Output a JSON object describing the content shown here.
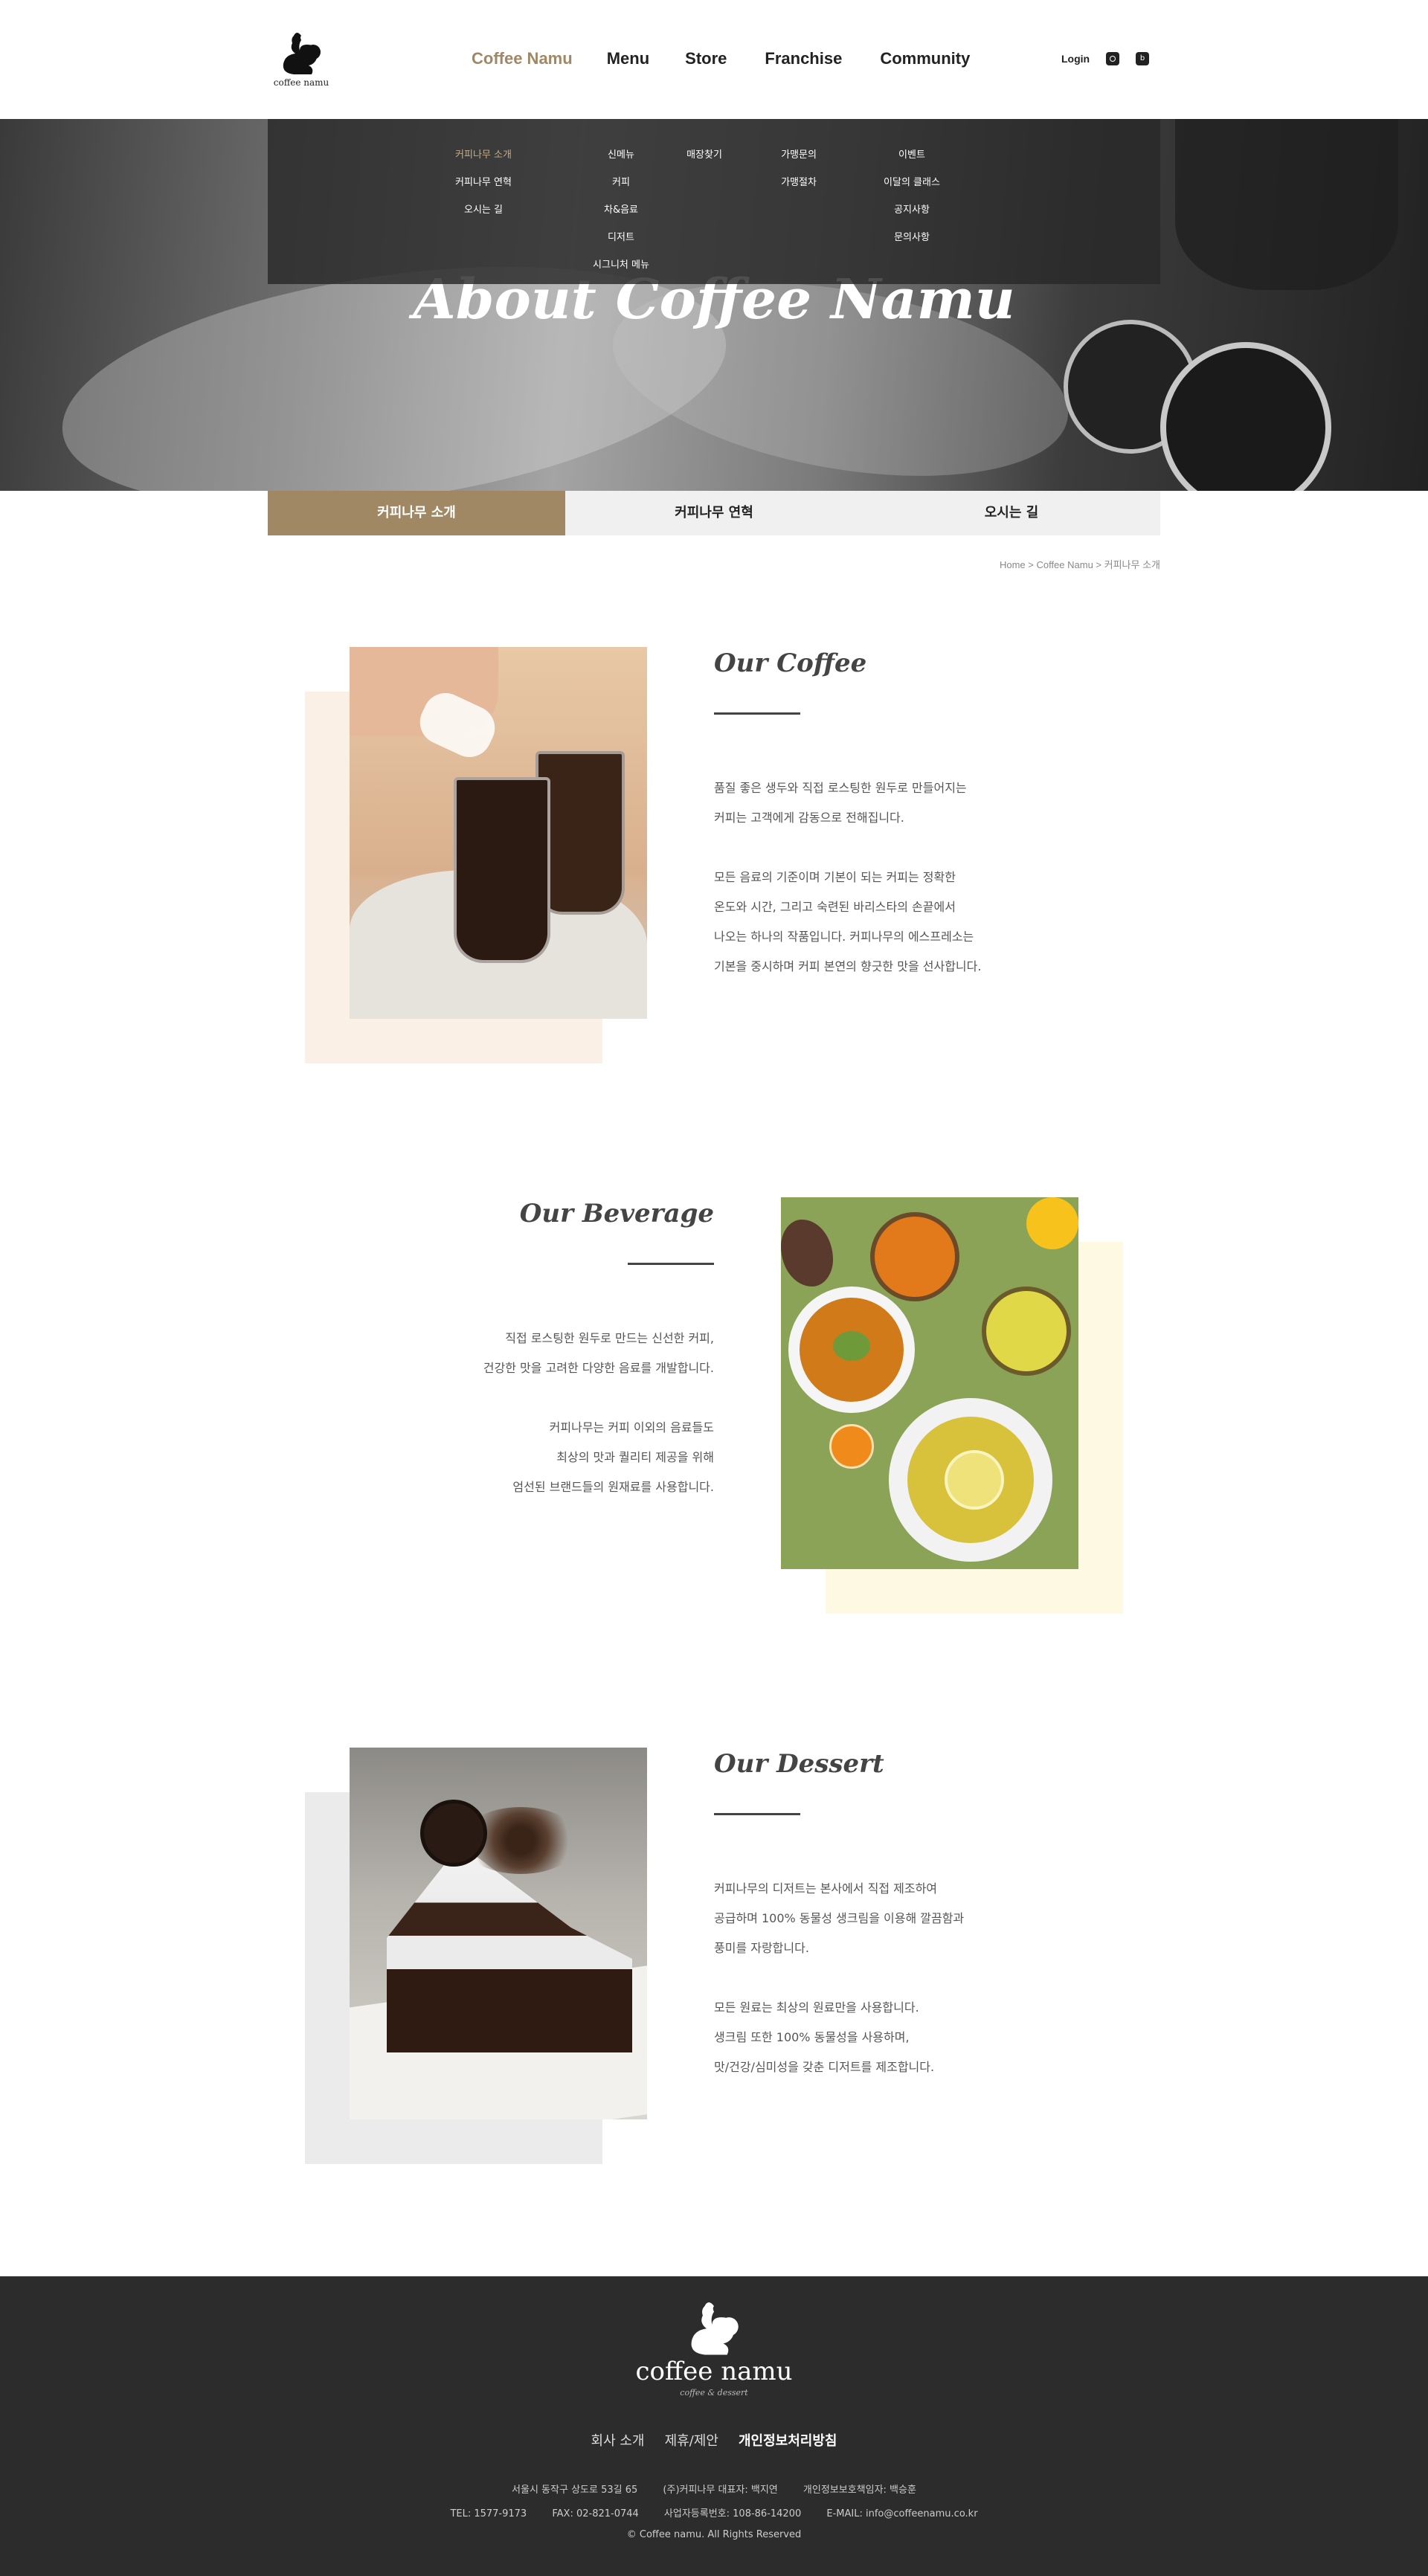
{
  "header": {
    "logo_text": "coffee namu",
    "nav": [
      "Coffee Namu",
      "Menu",
      "Store",
      "Franchise",
      "Community"
    ],
    "login": "Login",
    "icons": [
      "instagram-icon",
      "blog-icon"
    ]
  },
  "submenu": {
    "coffee_namu": [
      "커피나무 소개",
      "커피나무 연혁",
      "오시는 길"
    ],
    "menu": [
      "신메뉴",
      "커피",
      "차&음료",
      "디저트",
      "시그니처 메뉴"
    ],
    "store": [
      "매장찾기"
    ],
    "franchise": [
      "가맹문의",
      "가맹절차"
    ],
    "community": [
      "이벤트",
      "이달의 클래스",
      "공지사항",
      "문의사항"
    ]
  },
  "hero": {
    "title": "About Coffee Namu"
  },
  "tabs": [
    "커피나무 소개",
    "커피나무 연혁",
    "오시는 길"
  ],
  "breadcrumb": "Home > Coffee Namu > 커피나무 소개",
  "sections": {
    "coffee": {
      "title": "Our Coffee",
      "p1": [
        "품질 좋은 생두와 직접 로스팅한 원두로 만들어지는",
        "커피는 고객에게 감동으로 전해집니다."
      ],
      "p2": [
        "모든 음료의 기준이며 기본이 되는 커피는 정확한",
        "온도와 시간, 그리고 숙련된 바리스타의 손끝에서",
        "나오는 하나의 작품입니다. 커피나무의 에스프레소는",
        "기본을 중시하며 커피 본연의 향긋한 맛을 선사합니다."
      ]
    },
    "beverage": {
      "title": "Our Beverage",
      "p1": [
        "직접 로스팅한 원두로 만드는 신선한 커피,",
        "건강한 맛을 고려한 다양한 음료를 개발합니다."
      ],
      "p2": [
        "커피나무는 커피 이외의 음료들도",
        "최상의 맛과 퀄리티 제공을 위해",
        "엄선된 브랜드들의 원재료를 사용합니다."
      ]
    },
    "dessert": {
      "title": "Our Dessert",
      "p1": [
        "커피나무의 디저트는 본사에서 직접 제조하여",
        "공급하며 100% 동물성 생크림을 이용해 깔끔함과",
        "풍미를 자랑합니다."
      ],
      "p2": [
        "모든 원료는 최상의 원료만을 사용합니다.",
        "생크림 또한 100% 동물성을 사용하며,",
        "맛/건강/심미성을 갖춘 디저트를 제조합니다."
      ]
    }
  },
  "footer": {
    "brand": "coffee namu",
    "tagline": "coffee & dessert",
    "links": [
      "회사 소개",
      "제휴/제안",
      "개인정보처리방침"
    ],
    "address": "서울시 동작구 상도로 53길 65",
    "ceo": "(주)커피나무 대표자: 백지연",
    "privacy_officer": "개인정보보호책임자: 백승훈",
    "tel": "TEL: 1577-9173",
    "fax": "FAX: 02-821-0744",
    "biz_no": "사업자등록번호: 108-86-14200",
    "email": "E-MAIL: info@coffeenamu.co.kr",
    "copyright": "© Coffee namu. All Rights Reserved"
  },
  "colors": {
    "accent": "#a08865",
    "coffee_bg": "#fbf0e6",
    "beverage_bg": "#fdf9e3",
    "dessert_bg": "#ebebeb",
    "footer_bg": "#2c2c2c"
  }
}
